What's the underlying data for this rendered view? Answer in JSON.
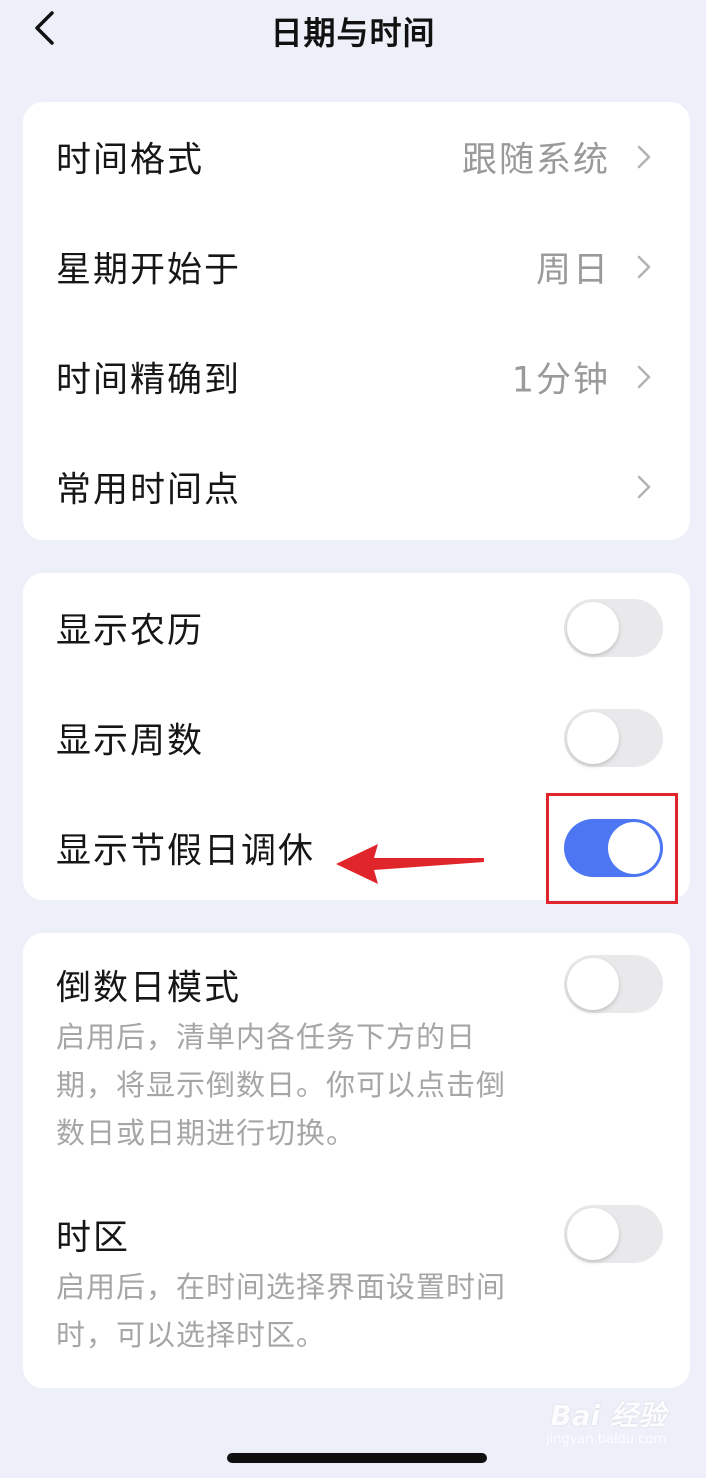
{
  "header": {
    "title": "日期与时间",
    "back_icon": "chevron-left-icon"
  },
  "general": {
    "rows": [
      {
        "label": "时间格式",
        "value": "跟随系统"
      },
      {
        "label": "星期开始于",
        "value": "周日"
      },
      {
        "label": "时间精确到",
        "value": "1分钟"
      },
      {
        "label": "常用时间点",
        "value": ""
      }
    ]
  },
  "display": {
    "rows": [
      {
        "label": "显示农历",
        "enabled": false
      },
      {
        "label": "显示周数",
        "enabled": false
      },
      {
        "label": "显示节假日调休",
        "enabled": true
      }
    ]
  },
  "advanced": {
    "rows": [
      {
        "label": "倒数日模式",
        "enabled": false,
        "description": "启用后，清单内各任务下方的日期，将显示倒数日。你可以点击倒数日或日期进行切换。"
      },
      {
        "label": "时区",
        "enabled": false,
        "description": "启用后，在时间选择界面设置时间时，可以选择时区。"
      }
    ]
  },
  "annotation": {
    "box_color": "#e0252b",
    "arrow_color": "#e0252b"
  },
  "watermark": {
    "logo": "Bai 经验",
    "sub": "jingyan.baidu.com"
  },
  "colors": {
    "background": "#eef0f9",
    "toggle_on": "#4d76f2",
    "toggle_off": "#e9e9eb"
  }
}
